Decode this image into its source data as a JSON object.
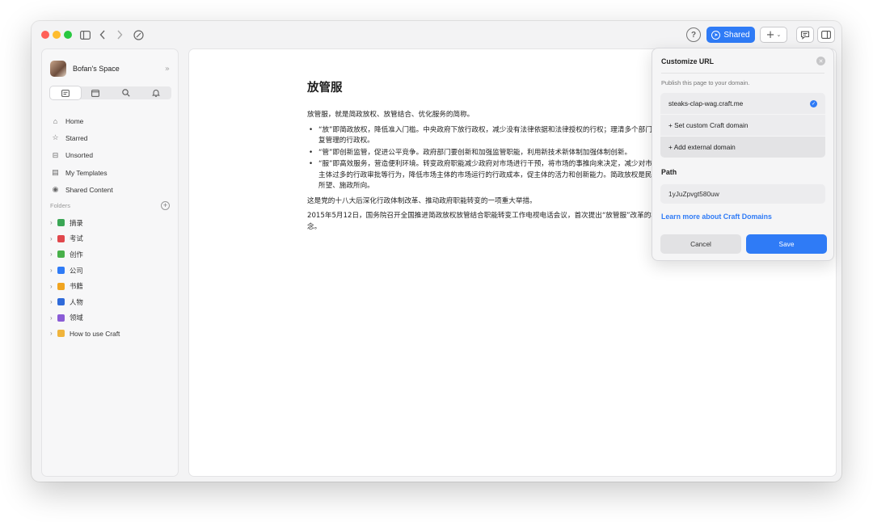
{
  "titlebar": {
    "icons": [
      "sidebar-toggle-icon",
      "back-chevron-icon",
      "forward-chevron-icon",
      "clock-history-icon"
    ],
    "help": "?",
    "shared_label": "Shared",
    "plus": "+",
    "accent": "#2f7bf6"
  },
  "sidebar": {
    "space_name": "Bofan's Space",
    "collapse": "»",
    "tool_icons": [
      "doc-icon",
      "calendar-icon",
      "search-icon",
      "bell-icon"
    ],
    "nav": [
      {
        "icon": "home-icon",
        "glyph": "⌂",
        "label": "Home"
      },
      {
        "icon": "star-icon",
        "glyph": "☆",
        "label": "Starred"
      },
      {
        "icon": "inbox-icon",
        "glyph": "⊟",
        "label": "Unsorted"
      },
      {
        "icon": "template-icon",
        "glyph": "▤",
        "label": "My Templates"
      },
      {
        "icon": "shared-icon",
        "glyph": "◉",
        "label": "Shared Content"
      }
    ],
    "folders_label": "Folders",
    "folders": [
      {
        "label": "摘录",
        "color": "#3aa655"
      },
      {
        "label": "考试",
        "color": "#e0474c"
      },
      {
        "label": "创作",
        "color": "#48b04a"
      },
      {
        "label": "公司",
        "color": "#2f7bf6"
      },
      {
        "label": "书籍",
        "color": "#f0a420"
      },
      {
        "label": "人物",
        "color": "#2f6ad9"
      },
      {
        "label": "领域",
        "color": "#8a5cd6"
      },
      {
        "label": "How to use Craft",
        "color": "#f0b43c"
      }
    ]
  },
  "doc": {
    "title": "放管服",
    "intro": "放管服，就是简政放权、放管结合、优化服务的简称。",
    "bullets": [
      "“放”即简政放权，降低准入门槛。中央政府下放行政权，减少没有法律依据和法律授权的行权；理清多个部门重复管理的行政权。",
      "“管”即创新监管，促进公平竞争。政府部门要创新和加强监管职能，利用新技术新体制加强体制创新。",
      "“服”即高效服务，营造便利环境。转变政府职能减少政府对市场进行干预，将市场的事推向来决定，减少对市场主体过多的行政审批等行为，降低市场主体的市场运行的行政成本，促主体的活力和创新能力。简政放权是民之所望、施政所向。"
    ],
    "para2": "这是党的十八大后深化行政体制改革、推动政府职能转变的一项重大举措。",
    "para3": "2015年5月12日，国务院召开全国推进简政放权放管结合职能转变工作电视电话会议，首次提出“放管服”改革的概念。"
  },
  "popover": {
    "title": "Customize URL",
    "description": "Publish this page to your domain.",
    "options": [
      "steaks-clap-wag.craft.me",
      "+ Set custom Craft domain",
      "+ Add external domain"
    ],
    "path_label": "Path",
    "path_value": "1yJuZpvgt580uw",
    "learn_more": "Learn more about Craft Domains",
    "cancel": "Cancel",
    "save": "Save"
  }
}
